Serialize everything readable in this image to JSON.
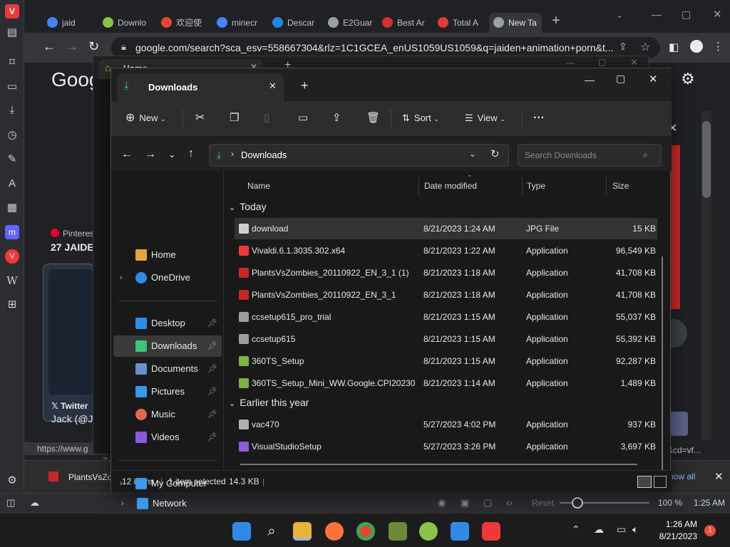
{
  "vivaldi_sidebar": {
    "icons": [
      "vivaldi-logo-icon",
      "panel-icon",
      "bookmark-icon",
      "reader-icon",
      "download-icon",
      "history-icon",
      "notes-icon",
      "translate-icon",
      "calendar-icon",
      "mastodon-icon",
      "vivaldi-icon",
      "wikipedia-icon",
      "add-panel-icon",
      "settings-icon"
    ]
  },
  "browser": {
    "tabs": [
      {
        "label": "jaid",
        "color": "#4285f4"
      },
      {
        "label": "Downlo",
        "color": "#8bc34a"
      },
      {
        "label": "欢迎使",
        "color": "#ea4335"
      },
      {
        "label": "minecr",
        "color": "#4285f4"
      },
      {
        "label": "Descar",
        "color": "#1e88e5"
      },
      {
        "label": "E2Guar",
        "color": "#9aa0a6"
      },
      {
        "label": "Best Ar",
        "color": "#d32f2f"
      },
      {
        "label": "Total A",
        "color": "#e53935"
      },
      {
        "label": "New Ta",
        "color": "#9aa0a6"
      }
    ],
    "url": "google.com/search?sca_esv=558667304&rlz=1C1GCEA_enUS1059US1059&q=jaiden+animation+porn&t...",
    "page_fragments": {
      "google_logo": "Goog",
      "pinterest": "Pinteres",
      "pinterest_sub": "27 JAIDE",
      "twitter": "Twitter",
      "twitter_sub": "Jack (@J",
      "status_url": "https://www.g",
      "url_tail": "&cd=vf...",
      "count_frag": "7 i"
    },
    "download_bar": {
      "file": "PlantsVsZo",
      "show_all": "how all"
    },
    "vivaldi_status": {
      "reset": "Reset",
      "zoom": "100 %",
      "time": "1:25 AM"
    }
  },
  "home_window": {
    "title": "Home"
  },
  "explorer": {
    "tab_title": "Downloads",
    "toolbar": {
      "new": "New",
      "sort": "Sort",
      "view": "View"
    },
    "breadcrumb": "Downloads",
    "search_placeholder": "Search Downloads",
    "nav": {
      "home": "Home",
      "onedrive": "OneDrive",
      "desktop": "Desktop",
      "downloads": "Downloads",
      "documents": "Documents",
      "pictures": "Pictures",
      "music": "Music",
      "videos": "Videos",
      "mycomputer": "My Computer",
      "network": "Network"
    },
    "columns": {
      "name": "Name",
      "date": "Date modified",
      "type": "Type",
      "size": "Size"
    },
    "groups": {
      "today": "Today",
      "earlier": "Earlier this year"
    },
    "today_files": [
      {
        "name": "download",
        "date": "8/21/2023 1:24 AM",
        "type": "JPG File",
        "size": "15 KB",
        "color": "#d0d0d0"
      },
      {
        "name": "Vivaldi.6.1.3035.302.x64",
        "date": "8/21/2023 1:22 AM",
        "type": "Application",
        "size": "96,549 KB",
        "color": "#ef3939"
      },
      {
        "name": "PlantsVsZombies_20110922_EN_3_1 (1)",
        "date": "8/21/2023 1:18 AM",
        "type": "Application",
        "size": "41,708 KB",
        "color": "#c62828"
      },
      {
        "name": "PlantsVsZombies_20110922_EN_3_1",
        "date": "8/21/2023 1:18 AM",
        "type": "Application",
        "size": "41,708 KB",
        "color": "#c62828"
      },
      {
        "name": "ccsetup615_pro_trial",
        "date": "8/21/2023 1:15 AM",
        "type": "Application",
        "size": "55,037 KB",
        "color": "#9e9e9e"
      },
      {
        "name": "ccsetup615",
        "date": "8/21/2023 1:15 AM",
        "type": "Application",
        "size": "55,392 KB",
        "color": "#9e9e9e"
      },
      {
        "name": "360TS_Setup",
        "date": "8/21/2023 1:15 AM",
        "type": "Application",
        "size": "92,287 KB",
        "color": "#7cb342"
      },
      {
        "name": "360TS_Setup_Mini_WW.Google.CPI20230...",
        "date": "8/21/2023 1:14 AM",
        "type": "Application",
        "size": "1,489 KB",
        "color": "#7cb342"
      }
    ],
    "earlier_files": [
      {
        "name": "vac470",
        "date": "5/27/2023 4:02 PM",
        "type": "Application",
        "size": "937 KB",
        "color": "#b0b0b0"
      },
      {
        "name": "VisualStudioSetup",
        "date": "5/27/2023 3:26 PM",
        "type": "Application",
        "size": "3,697 KB",
        "color": "#8e5cd9"
      }
    ],
    "status": {
      "items": "12 items",
      "selected": "1 item selected",
      "size": "14.3 KB"
    }
  },
  "taskbar": {
    "time": "1:26 AM",
    "date": "8/21/2023",
    "notif": "1"
  }
}
